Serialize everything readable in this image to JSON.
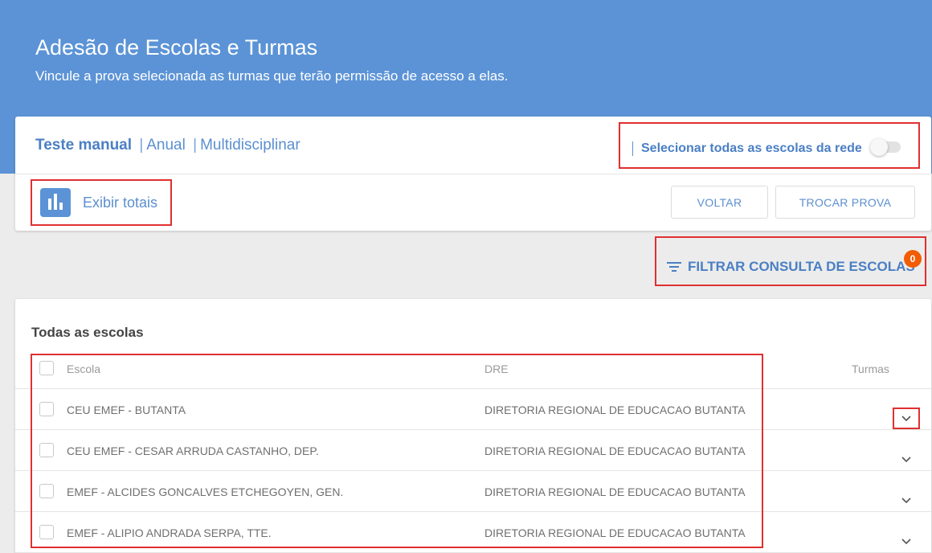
{
  "header": {
    "title": "Adesão de Escolas e Turmas",
    "subtitle": "Vincule a prova selecionada as turmas que terão permissão de acesso a elas."
  },
  "prova": {
    "name": "Teste manual",
    "sep1": "|",
    "type": "Anual",
    "sep2": "|",
    "subject": "Multidisciplinar"
  },
  "select_all": {
    "label": "Selecionar todas as escolas da rede",
    "enabled": false
  },
  "totals_button": {
    "label": "Exibir totais",
    "icon": "bar-chart-icon"
  },
  "buttons": {
    "back": "VOLTAR",
    "change_test": "TROCAR PROVA"
  },
  "filter": {
    "label": "FILTRAR CONSULTA DE ESCOLAS",
    "count": "0",
    "icon": "filter-icon"
  },
  "list": {
    "title": "Todas as escolas",
    "columns": {
      "school": "Escola",
      "dre": "DRE",
      "classes": "Turmas"
    },
    "rows": [
      {
        "school": "CEU EMEF - BUTANTA",
        "dre": "DIRETORIA REGIONAL DE EDUCACAO BUTANTA"
      },
      {
        "school": "CEU EMEF - CESAR ARRUDA CASTANHO, DEP.",
        "dre": "DIRETORIA REGIONAL DE EDUCACAO BUTANTA"
      },
      {
        "school": "EMEF - ALCIDES GONCALVES ETCHEGOYEN, GEN.",
        "dre": "DIRETORIA REGIONAL DE EDUCACAO BUTANTA"
      },
      {
        "school": "EMEF - ALIPIO ANDRADA SERPA, TTE.",
        "dre": "DIRETORIA REGIONAL DE EDUCACAO BUTANTA"
      }
    ]
  },
  "colors": {
    "header_bg": "#5b93d6",
    "accent": "#4a7fc4",
    "badge": "#f25c05",
    "highlight": "#e03030"
  }
}
